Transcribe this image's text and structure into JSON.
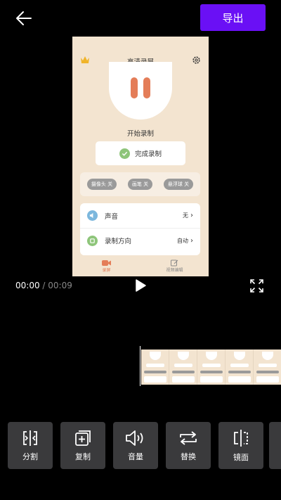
{
  "header": {
    "export_label": "导出"
  },
  "preview": {
    "app_title": "高清录屏",
    "start_label": "开始录制",
    "finish_label": "完成录制",
    "toggles": [
      {
        "label": "摄像头 关"
      },
      {
        "label": "画笔 关"
      },
      {
        "label": "悬浮球 关"
      }
    ],
    "settings": [
      {
        "label": "声音",
        "value": "无",
        "icon": "speaker-icon",
        "color": "#7cb7dd"
      },
      {
        "label": "录制方向",
        "value": "自动",
        "icon": "rotate-icon",
        "color": "#8ec57a"
      }
    ],
    "nav": [
      {
        "label": "录屏",
        "icon": "record-icon",
        "active": true
      },
      {
        "label": "视频编辑",
        "icon": "edit-icon",
        "active": false
      }
    ]
  },
  "player": {
    "current_time": "00:00",
    "separator": " / ",
    "duration": "00:09"
  },
  "tools": [
    {
      "label": "分割",
      "icon": "split-icon"
    },
    {
      "label": "复制",
      "icon": "copy-icon"
    },
    {
      "label": "音量",
      "icon": "volume-icon"
    },
    {
      "label": "替换",
      "icon": "replace-icon"
    },
    {
      "label": "镜面",
      "icon": "mirror-icon"
    }
  ],
  "colors": {
    "accent": "#6a10f5",
    "preview_bg": "#f3e4d0",
    "record_accent": "#e47d58",
    "tool_bg": "#3a3a3c"
  }
}
